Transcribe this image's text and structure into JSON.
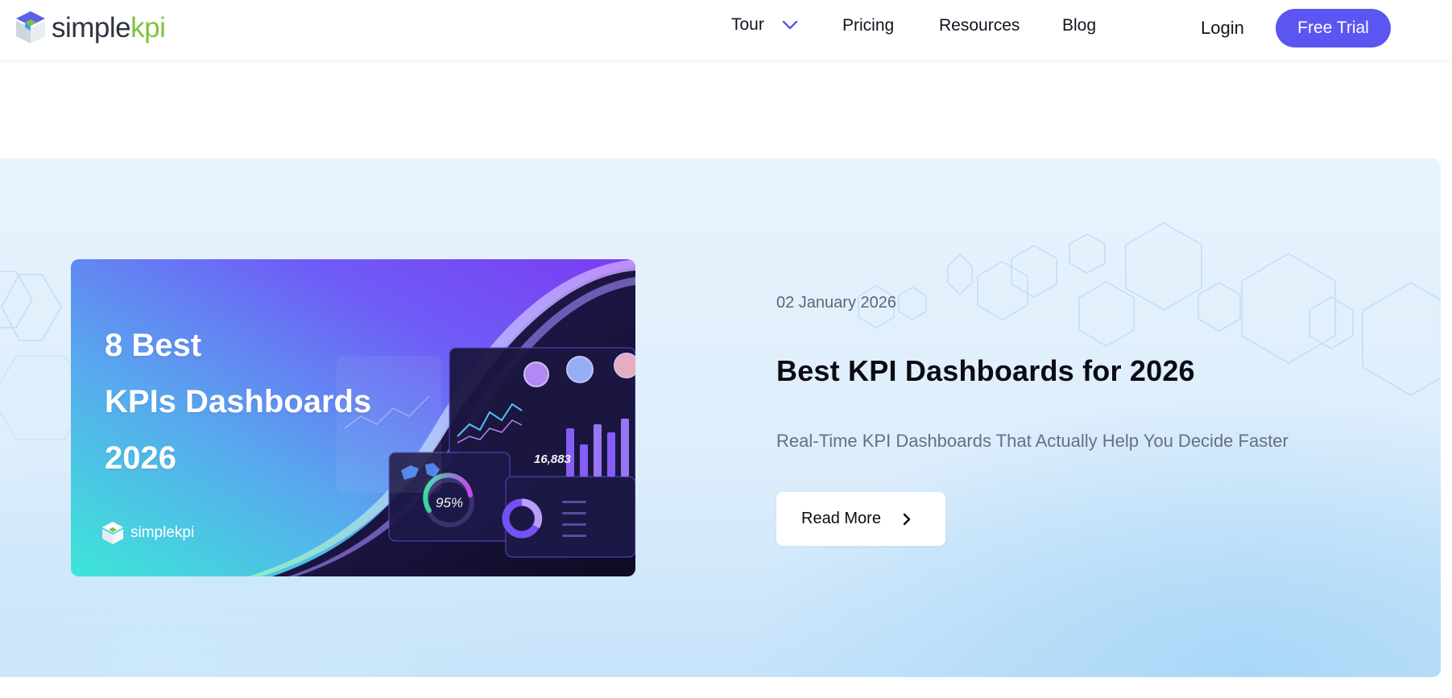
{
  "header": {
    "logo": {
      "text_part1": "simple",
      "text_part2": "kpi"
    },
    "nav": {
      "tour": "Tour",
      "pricing": "Pricing",
      "resources": "Resources",
      "blog": "Blog",
      "login": "Login"
    },
    "cta_label": "Free Trial"
  },
  "featured_post": {
    "image": {
      "heading": "8 Best\nKPIs Dashboards\n2026",
      "brand": "simplekpi"
    },
    "date": "02 January 2026",
    "title": "Best KPI Dashboards for 2026",
    "subtitle": "Real-Time KPI Dashboards That Actually Help You Decide Faster",
    "read_more_label": "Read More"
  },
  "icons": [
    "simplekpi-logo-icon",
    "chevron-down-icon",
    "chevron-right-icon"
  ],
  "colors": {
    "brand_primary": "#5b55f1",
    "logo_green": "#7fc241",
    "logo_dark": "#2f3441",
    "panel_bg": "#e3f1fd"
  }
}
